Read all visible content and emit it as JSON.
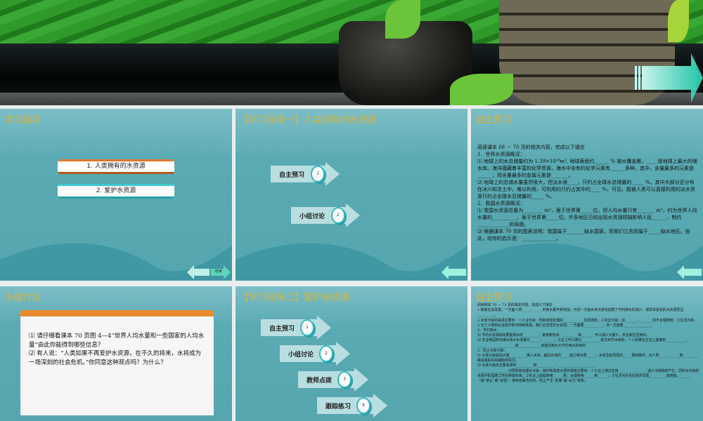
{
  "slides": [
    {
      "title": "学习指导",
      "items": [
        "1. 人类拥有的水资源",
        "2. 爱护水资源"
      ],
      "nav_label": "结束"
    },
    {
      "title": "【学习指导一】人类拥有的水资源",
      "steps": [
        {
          "label": "自主预习",
          "num": "1"
        },
        {
          "label": "小组讨论",
          "num": "2"
        }
      ]
    },
    {
      "title": "自主预习",
      "body": "阅读课本 68 － 70 页的相关内容，完成以下填空\n1．世界水资源概况：\n⑴ 地球上的水总储量约为 1.39×10¹⁸m³, 地球表面约______ % 被水覆盖着，____ 是地球上最大的储水库。海洋蕴藏着丰富的化学资源，海水中含有的化学元素有______多种，其中，含量最多的元素是______；而含量最多的金属元素是_______。\n⑵ 地球上的总储水量虽然很大，但淡水很____，只约占全球水总储量的_____ %，其中大部分还分布在冰川和冻土中，难以利用，可利用的只约占其中的____ %，可见，能被人类可以直接利用的淡水资源只约占全球水总储量的_____ %。\n2．我国水资源概况：\n⑴ 我国水资源总量为________ m³，居于世界第_____位，但人均水量只有_______ m³，约为世界人均水量的__________，居于世界第_____位，许多地区已经出现水资源短缺影响人民______、制约_____________的局面。\n⑵ 根据课本 70 页的图表说明：我国属于_______缺水国家，而我们江苏则属于_____缺水地区。由此，给你的启示是：______________。"
    },
    {
      "title": "小组讨论",
      "body": "⑴ 请仔细看课本 70 页图 4—4“世界人均水量和一些国家的人均水量”由此你能得到哪些信息？\n⑵ 有人说：“人类如果不再爱护水资源，在不久的将来，水将成为一场深刻的社会危机。”你同意这种观点吗？为什么？"
    },
    {
      "title": "【学习指导二】爱护水资源",
      "steps": [
        {
          "label": "自主预习",
          "num": "1"
        },
        {
          "label": "小组讨论",
          "num": "2"
        },
        {
          "label": "教师点拨",
          "num": "3"
        },
        {
          "label": "跟踪练习",
          "num": "4"
        }
      ]
    },
    {
      "title": "自主预习",
      "body": "阅读课本 70 － 72 页的相关内容，完成以下填空\n1 随着社会发展，一方面人类_____、_____的用水量不断增加；可另一方面水体污染也加剧了可利用水的减少，使原本紧张的水资源更显__________。\n2 水体污染的来源主要有：①工业污染：例如未经处理的____________任意排放；②农业污染：如_______、_______的不合理使用；③生活污染。\n3 为了人类和社会经济的可持续发展，我们必须爱护水资源，一方面要___________；另一方面要________________。\n4．节约用水：\n⑴ 节约水资源就是要提高水的_________，使用新技术、_________和_______ 可以减少大量工、农业和生活用水。\n⑵ 农业和园林浇灌水改大水漫灌为______、______；工业上可以通过___________来达到节水目的；个人如果在生活上能做到____________、______________________或_____________就能达到大大节约用水的目的\n5．防止水体污染：\n⑴ 水体污染是指大量__________排入水体，超过水体的_____能力使水质_____，水体及其周围的_____遭到破坏，对人类_____、_____和_________等造成损失和威胁的情况。\n⑵ 水体污染的主要来源有__________和__________、______________________\n__________________⑶预防和治理水污染，保护和改善水质的措施主要有：①工业上通过应用__________、_____减少污染物的产生，同时对污染的水体作处理使之符合排放标准；②农业上提倡使用______肥，合理使用______和______；③生活污水也应逐步实现__________和排放。______（填“禁止”或“合理”）使用含磷洗衣粉，防止产生“赤潮”或“水华”现象。"
    }
  ],
  "colors": {
    "title_gold": "#d7b33c",
    "slide_teal": "#56a6af",
    "orange": "#e98a2c",
    "cyan": "#39c9cf"
  }
}
